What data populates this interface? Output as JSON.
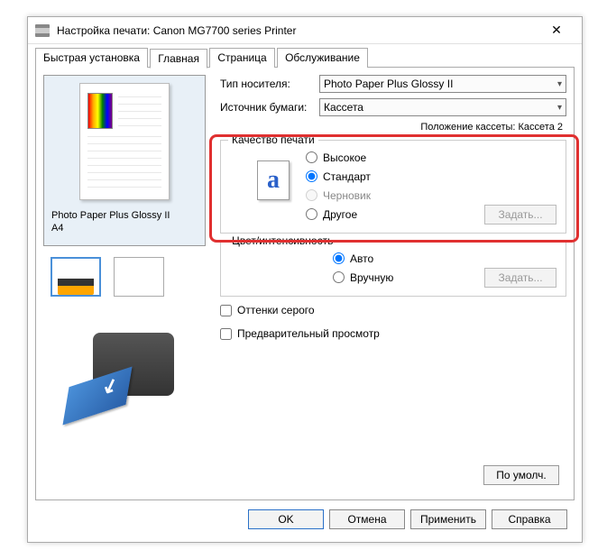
{
  "window": {
    "title": "Настройка печати: Canon MG7700 series Printer",
    "close_glyph": "✕"
  },
  "tabs": {
    "quick": "Быстрая установка",
    "main": "Главная",
    "page": "Страница",
    "maintenance": "Обслуживание"
  },
  "preview": {
    "caption_line1": "Photo Paper Plus Glossy II",
    "caption_line2": "A4"
  },
  "media": {
    "type_label": "Тип носителя:",
    "type_value": "Photo Paper Plus Glossy II",
    "source_label": "Источник бумаги:",
    "source_value": "Кассета",
    "cassette_pos": "Положение кассеты: Кассета 2"
  },
  "quality": {
    "legend": "Качество печати",
    "icon_glyph": "a",
    "options": {
      "high": "Высокое",
      "standard": "Стандарт",
      "draft": "Черновик",
      "other": "Другое"
    },
    "set_button": "Задать..."
  },
  "color": {
    "legend": "Цвет/интенсивность",
    "auto": "Авто",
    "manual": "Вручную",
    "set_button": "Задать..."
  },
  "checkboxes": {
    "grayscale": "Оттенки серого",
    "preview": "Предварительный просмотр"
  },
  "defaults_button": "По умолч.",
  "buttons": {
    "ok": "OK",
    "cancel": "Отмена",
    "apply": "Применить",
    "help": "Справка"
  }
}
